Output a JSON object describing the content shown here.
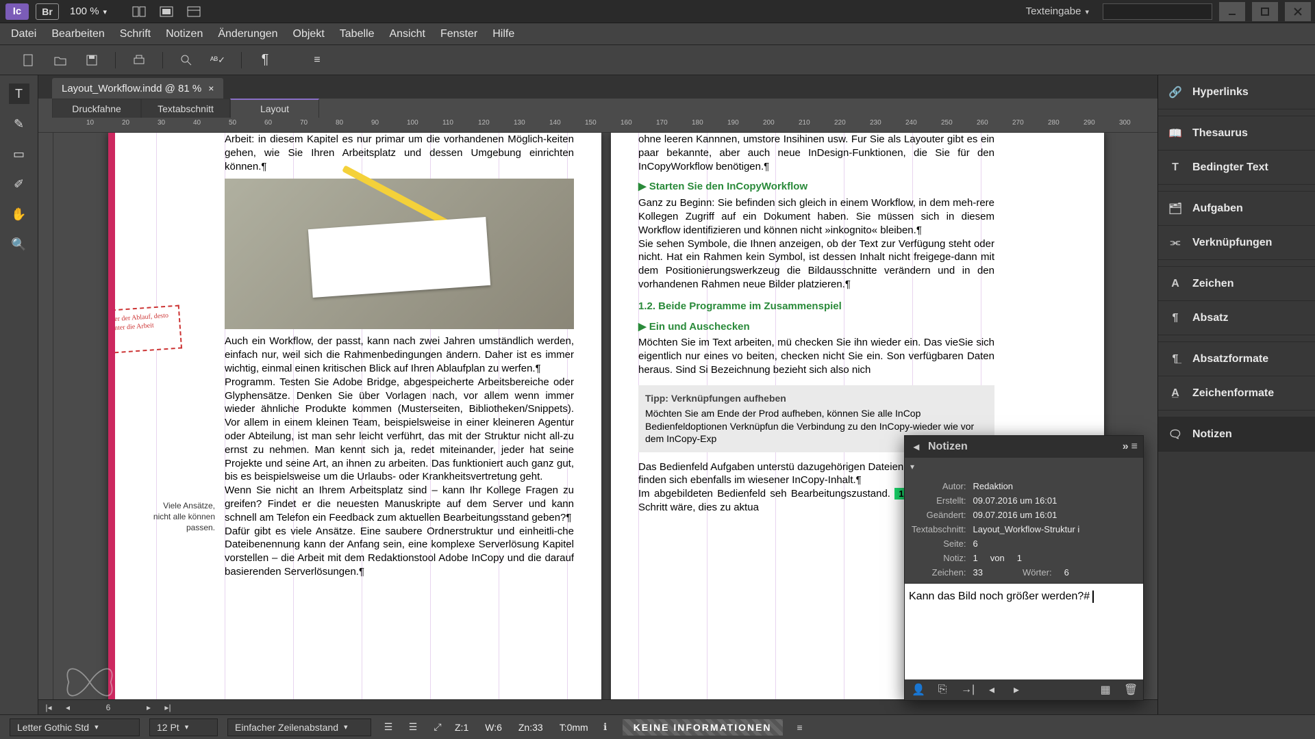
{
  "titlebar": {
    "app_badge": "Ic",
    "bridge_badge": "Br",
    "zoom": "100 %",
    "mode": "Texteingabe"
  },
  "menu": [
    "Datei",
    "Bearbeiten",
    "Schrift",
    "Notizen",
    "Änderungen",
    "Objekt",
    "Tabelle",
    "Ansicht",
    "Fenster",
    "Hilfe"
  ],
  "doc_tab": {
    "title": "Layout_Workflow.indd @ 81 %",
    "close": "×"
  },
  "view_tabs": [
    "Druckfahne",
    "Textabschnitt",
    "Layout"
  ],
  "ruler_ticks": [
    "10",
    "20",
    "30",
    "40",
    "50",
    "60",
    "70",
    "80",
    "90",
    "100",
    "110",
    "120",
    "130",
    "140",
    "150",
    "160",
    "170",
    "180",
    "190",
    "200",
    "210",
    "220",
    "230",
    "240",
    "250",
    "260",
    "270",
    "280",
    "290",
    "300"
  ],
  "page_left": {
    "intro": "Arbeit: in diesem Kapitel es nur primar um die vorhandenen Möglich-keiten gehen, wie Sie Ihren Arbeitsplatz und dessen Umgebung einrichten können.¶",
    "sticky": "Je klarer der Ablauf, desto effizienter die Arbeit",
    "para1": "Auch ein Workflow, der passt, kann nach zwei Jahren umständlich werden, einfach nur, weil sich die Rahmenbedingungen ändern. Daher ist es immer wichtig, einmal einen kritischen Blick auf Ihren Ablaufplan zu werfen.¶",
    "para2": "    Programm. Testen Sie Adobe Bridge, abgespeicherte Arbeitsbereiche oder Glyphensätze. Denken Sie über Vorlagen nach, vor allem wenn immer wieder ähnliche Produkte kommen (Musterseiten, Bibliotheken/Snippets). Vor allem in einem kleinen Team, beispielsweise in einer kleineren Agentur oder Abteilung, ist man sehr leicht verführt, das mit der Struktur nicht all-zu ernst zu nehmen. Man kennt sich ja, redet miteinander, jeder hat seine Projekte und seine Art, an ihnen zu arbeiten. Das funktioniert auch ganz gut, bis es beispielsweise um die Urlaubs- oder Krankheitsvertretung geht.",
    "para3": "    Wenn Sie nicht an Ihrem Arbeitsplatz sind – kann Ihr Kollege Fragen zu greifen? Findet er die neuesten Manuskripte auf dem Server und kann schnell am Telefon ein Feedback zum aktuellen Bearbeitungsstand geben?¶",
    "para4": "    Dafür gibt es viele Ansätze. Eine saubere Ordnerstruktur und einheitli-che Dateibenennung kann der Anfang sein, eine komplexe Serverlösung Kapitel vorstellen – die Arbeit mit dem Redaktionstool Adobe InCopy und die darauf basierenden Serverlösungen.¶",
    "caption": "Viele Ansätze,\nnicht alle können\npassen."
  },
  "page_right": {
    "intro": "ohne leeren Kannnen, umstore Insihinen usw. Fur Sie als Layouter gibt es ein paar bekannte, aber auch neue InDesign-Funktionen, die Sie für den InCopyWorkflow benötigen.¶",
    "h1": "Starten Sie den InCopyWorkflow",
    "p1": "Ganz zu Beginn: Sie befinden sich gleich in einem Workflow, in dem meh-rere Kollegen Zugriff auf ein Dokument haben. Sie müssen sich in diesem Workflow identifizieren und können nicht »inkognito« bleiben.¶",
    "p2": "    Sie sehen Symbole, die Ihnen anzeigen, ob der Text zur Verfügung steht oder nicht. Hat ein Rahmen kein Symbol, ist dessen Inhalt nicht freigege-dann mit dem Positionierungswerkzeug die Bildausschnitte verändern und in den vorhandenen Rahmen neue Bilder platzieren.¶",
    "h2": "1.2.   Beide Programme im Zusammenspiel",
    "h3": "Ein und Auschecken",
    "p3": "Möchten Sie im Text arbeiten, mü checken Sie ihn wieder ein. Das vieSie sich eigentlich nur eines vo beiten, checken nicht Sie ein. Son verfügbaren Daten heraus. Sind Si Bezeichnung bezieht sich also nich",
    "tip_title": "Tipp: Verknüpfungen aufheben",
    "tip_body": "Möchten Sie am Ende der Prod aufheben, können Sie alle InCop Bedienfeldoptionen Verknüpfun die Verbindung zu den InCopy-wieder wie vor dem InCopy-Exp",
    "p4a": "Das Bedienfeld Aufgaben unterstü dazugehörigen Dateien. InCopy-D net sind, finden sich ebenfalls im wiesener InCopy-Inhalt.¶",
    "p4b": "    Im abgebildeten Bedienfeld seh Bearbeitungszustand. ",
    "badge": "1",
    "p4c": " ist verwe nächste Schritt wäre, dies zu aktua"
  },
  "sidebar": {
    "items": [
      {
        "icon": "link",
        "label": "Hyperlinks"
      },
      {
        "icon": "book",
        "label": "Thesaurus"
      },
      {
        "icon": "Tc",
        "label": "Bedingter Text"
      },
      {
        "icon": "task",
        "label": "Aufgaben"
      },
      {
        "icon": "chain",
        "label": "Verknüpfungen"
      },
      {
        "icon": "A",
        "label": "Zeichen"
      },
      {
        "icon": "pilcrow",
        "label": "Absatz"
      },
      {
        "icon": "pfmt",
        "label": "Absatzformate"
      },
      {
        "icon": "cfmt",
        "label": "Zeichenformate"
      },
      {
        "icon": "note",
        "label": "Notizen"
      }
    ]
  },
  "notes_panel": {
    "title": "Notizen",
    "meta": {
      "author_label": "Autor:",
      "author": "Redaktion",
      "created_label": "Erstellt:",
      "created": "09.07.2016 um 16:01",
      "changed_label": "Geändert:",
      "changed": "09.07.2016 um 16:01",
      "section_label": "Textabschnitt:",
      "section": "Layout_Workflow-Struktur i",
      "page_label": "Seite:",
      "page": "6",
      "note_label": "Notiz:",
      "note_i": "1",
      "of_label": "von",
      "note_n": "1",
      "chars_label": "Zeichen:",
      "chars": "33",
      "words_label": "Wörter:",
      "words": "6"
    },
    "body": "Kann das Bild noch größer werden?#"
  },
  "status": {
    "font": "Letter Gothic Std",
    "size": "12 Pt",
    "leading": "Einfacher Zeilenabstand",
    "readout": {
      "z": "Z:1",
      "w": "W:6",
      "zn": "Zn:33",
      "t": "T:0mm"
    },
    "info": "KEINE INFORMATIONEN"
  },
  "pagenav": {
    "num": "6"
  }
}
